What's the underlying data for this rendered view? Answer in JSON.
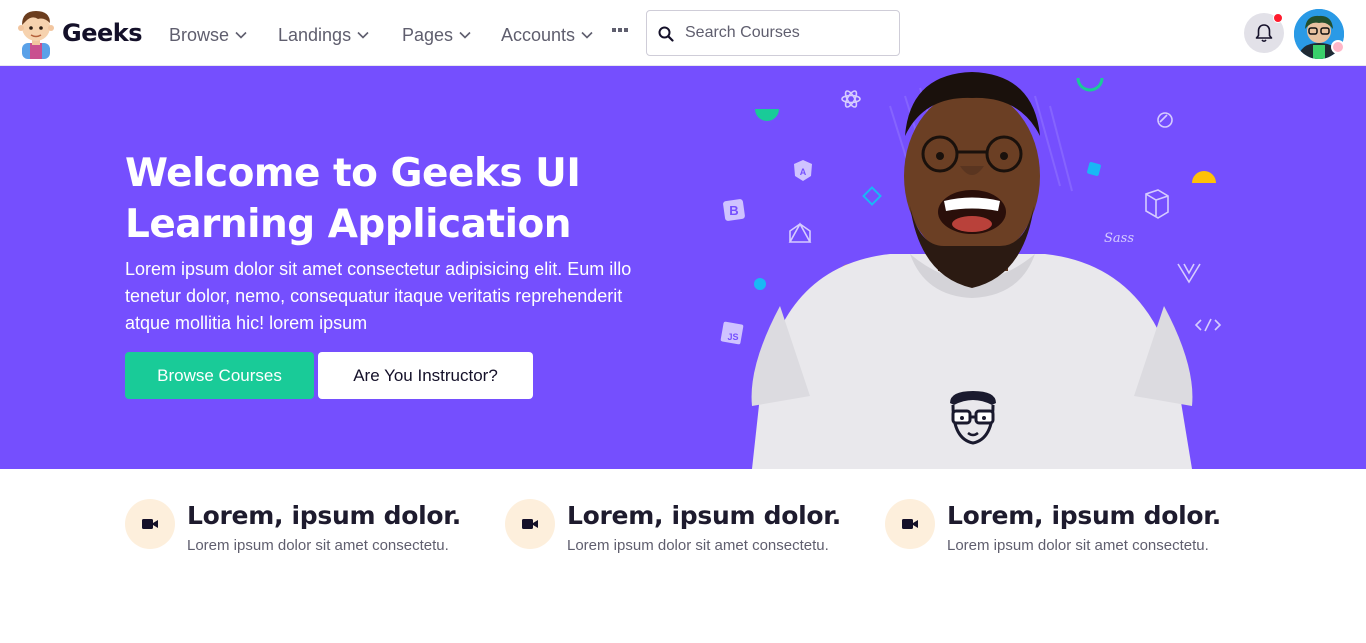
{
  "brand": {
    "name": "Geeks",
    "logo_icon": "geek-mascot-icon"
  },
  "nav": {
    "items": [
      {
        "label": "Browse",
        "icon": "chevron-down-icon"
      },
      {
        "label": "Landings",
        "icon": "chevron-down-icon"
      },
      {
        "label": "Pages",
        "icon": "chevron-down-icon"
      },
      {
        "label": "Accounts",
        "icon": "chevron-down-icon"
      }
    ],
    "more_icon": "more-dots-icon"
  },
  "search": {
    "placeholder": "Search Courses",
    "value": "",
    "icon": "search-icon"
  },
  "header_actions": {
    "notification_icon": "bell-icon",
    "has_unread": true,
    "avatar_status_color": "#ffb6c8"
  },
  "hero": {
    "title": "Welcome to Geeks UI Learning Application",
    "text": "Lorem ipsum dolor sit amet consectetur adipisicing elit. Eum illo tenetur dolor, nemo, consequatur itaque veritatis reprehenderit atque mollitia hic! lorem ipsum",
    "primary_button": "Browse Courses",
    "secondary_button": "Are You Instructor?",
    "background_color": "#754ffe",
    "tech_icons": [
      "react-icon",
      "angular-icon",
      "bootstrap-icon",
      "javascript-icon",
      "gatsby-icon",
      "laravel-icon",
      "sass-icon",
      "vue-icon",
      "code-icon"
    ]
  },
  "features": [
    {
      "title": "Lorem, ipsum dolor.",
      "text": "Lorem ipsum dolor sit amet consectetu.",
      "icon": "video-icon"
    },
    {
      "title": "Lorem, ipsum dolor.",
      "text": "Lorem ipsum dolor sit amet consectetu.",
      "icon": "video-icon"
    },
    {
      "title": "Lorem, ipsum dolor.",
      "text": "Lorem ipsum dolor sit amet consectetu.",
      "icon": "video-icon"
    }
  ],
  "colors": {
    "primary": "#754ffe",
    "success": "#19cb98",
    "feature_bg": "#fdefdc",
    "notification": "#ff1b2d"
  }
}
